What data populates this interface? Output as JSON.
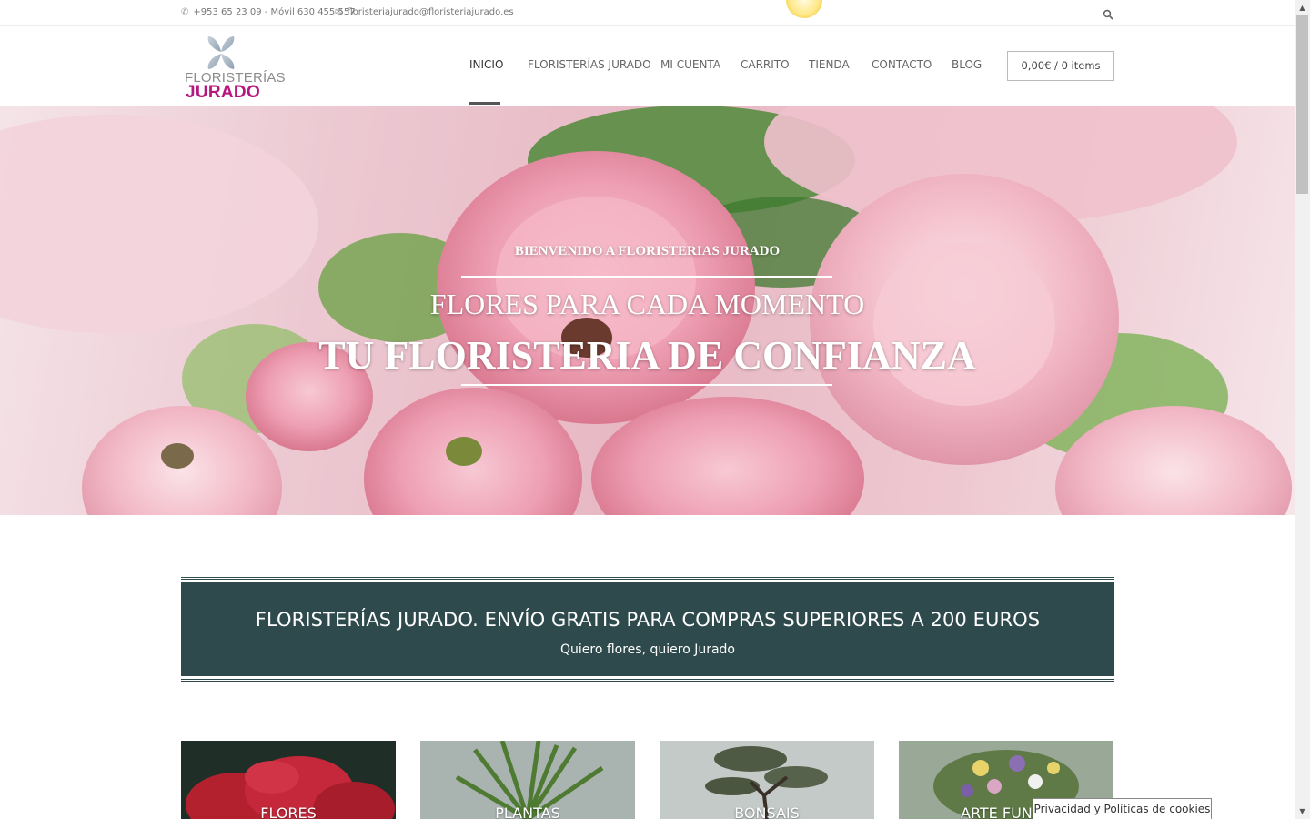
{
  "topbar": {
    "phone": "+953 65 23 09 - Móvil 630 455 557",
    "email": "floristeriajurado@floristeriajurado.es",
    "phone_icon": "phone-icon",
    "email_icon": "envelope-icon",
    "search_icon": "search-icon"
  },
  "logo": {
    "line1": "FLORISTERÍAS",
    "line2": "JURADO",
    "brand_color": "#b5177e"
  },
  "nav": {
    "items": [
      {
        "label": "INICIO",
        "active": true
      },
      {
        "label": "FLORISTERÍAS JURADO"
      },
      {
        "label": "MI CUENTA"
      },
      {
        "label": "CARRITO"
      },
      {
        "label": "TIENDA"
      },
      {
        "label": "CONTACTO"
      },
      {
        "label": "BLOG"
      }
    ],
    "cart_label": "0,00€ / 0 items"
  },
  "hero": {
    "kicker": "BIENVENIDO A FLORISTERIAS JURADO",
    "headline": "FLORES PARA CADA MOMENTO",
    "title": "TU FLORISTERIA DE CONFIANZA"
  },
  "banner": {
    "title": "FLORISTERÍAS JURADO. ENVÍO GRATIS PARA COMPRAS SUPERIORES A 200 EUROS",
    "subtitle": "Quiero flores, quiero Jurado",
    "background": "#2e4a4c"
  },
  "categories": [
    {
      "label": "FLORES"
    },
    {
      "label": "PLANTAS"
    },
    {
      "label": "BONSAIS"
    },
    {
      "label": "ARTE FUNER"
    }
  ],
  "cookie": {
    "label": "Privacidad y Políticas de cookies"
  }
}
